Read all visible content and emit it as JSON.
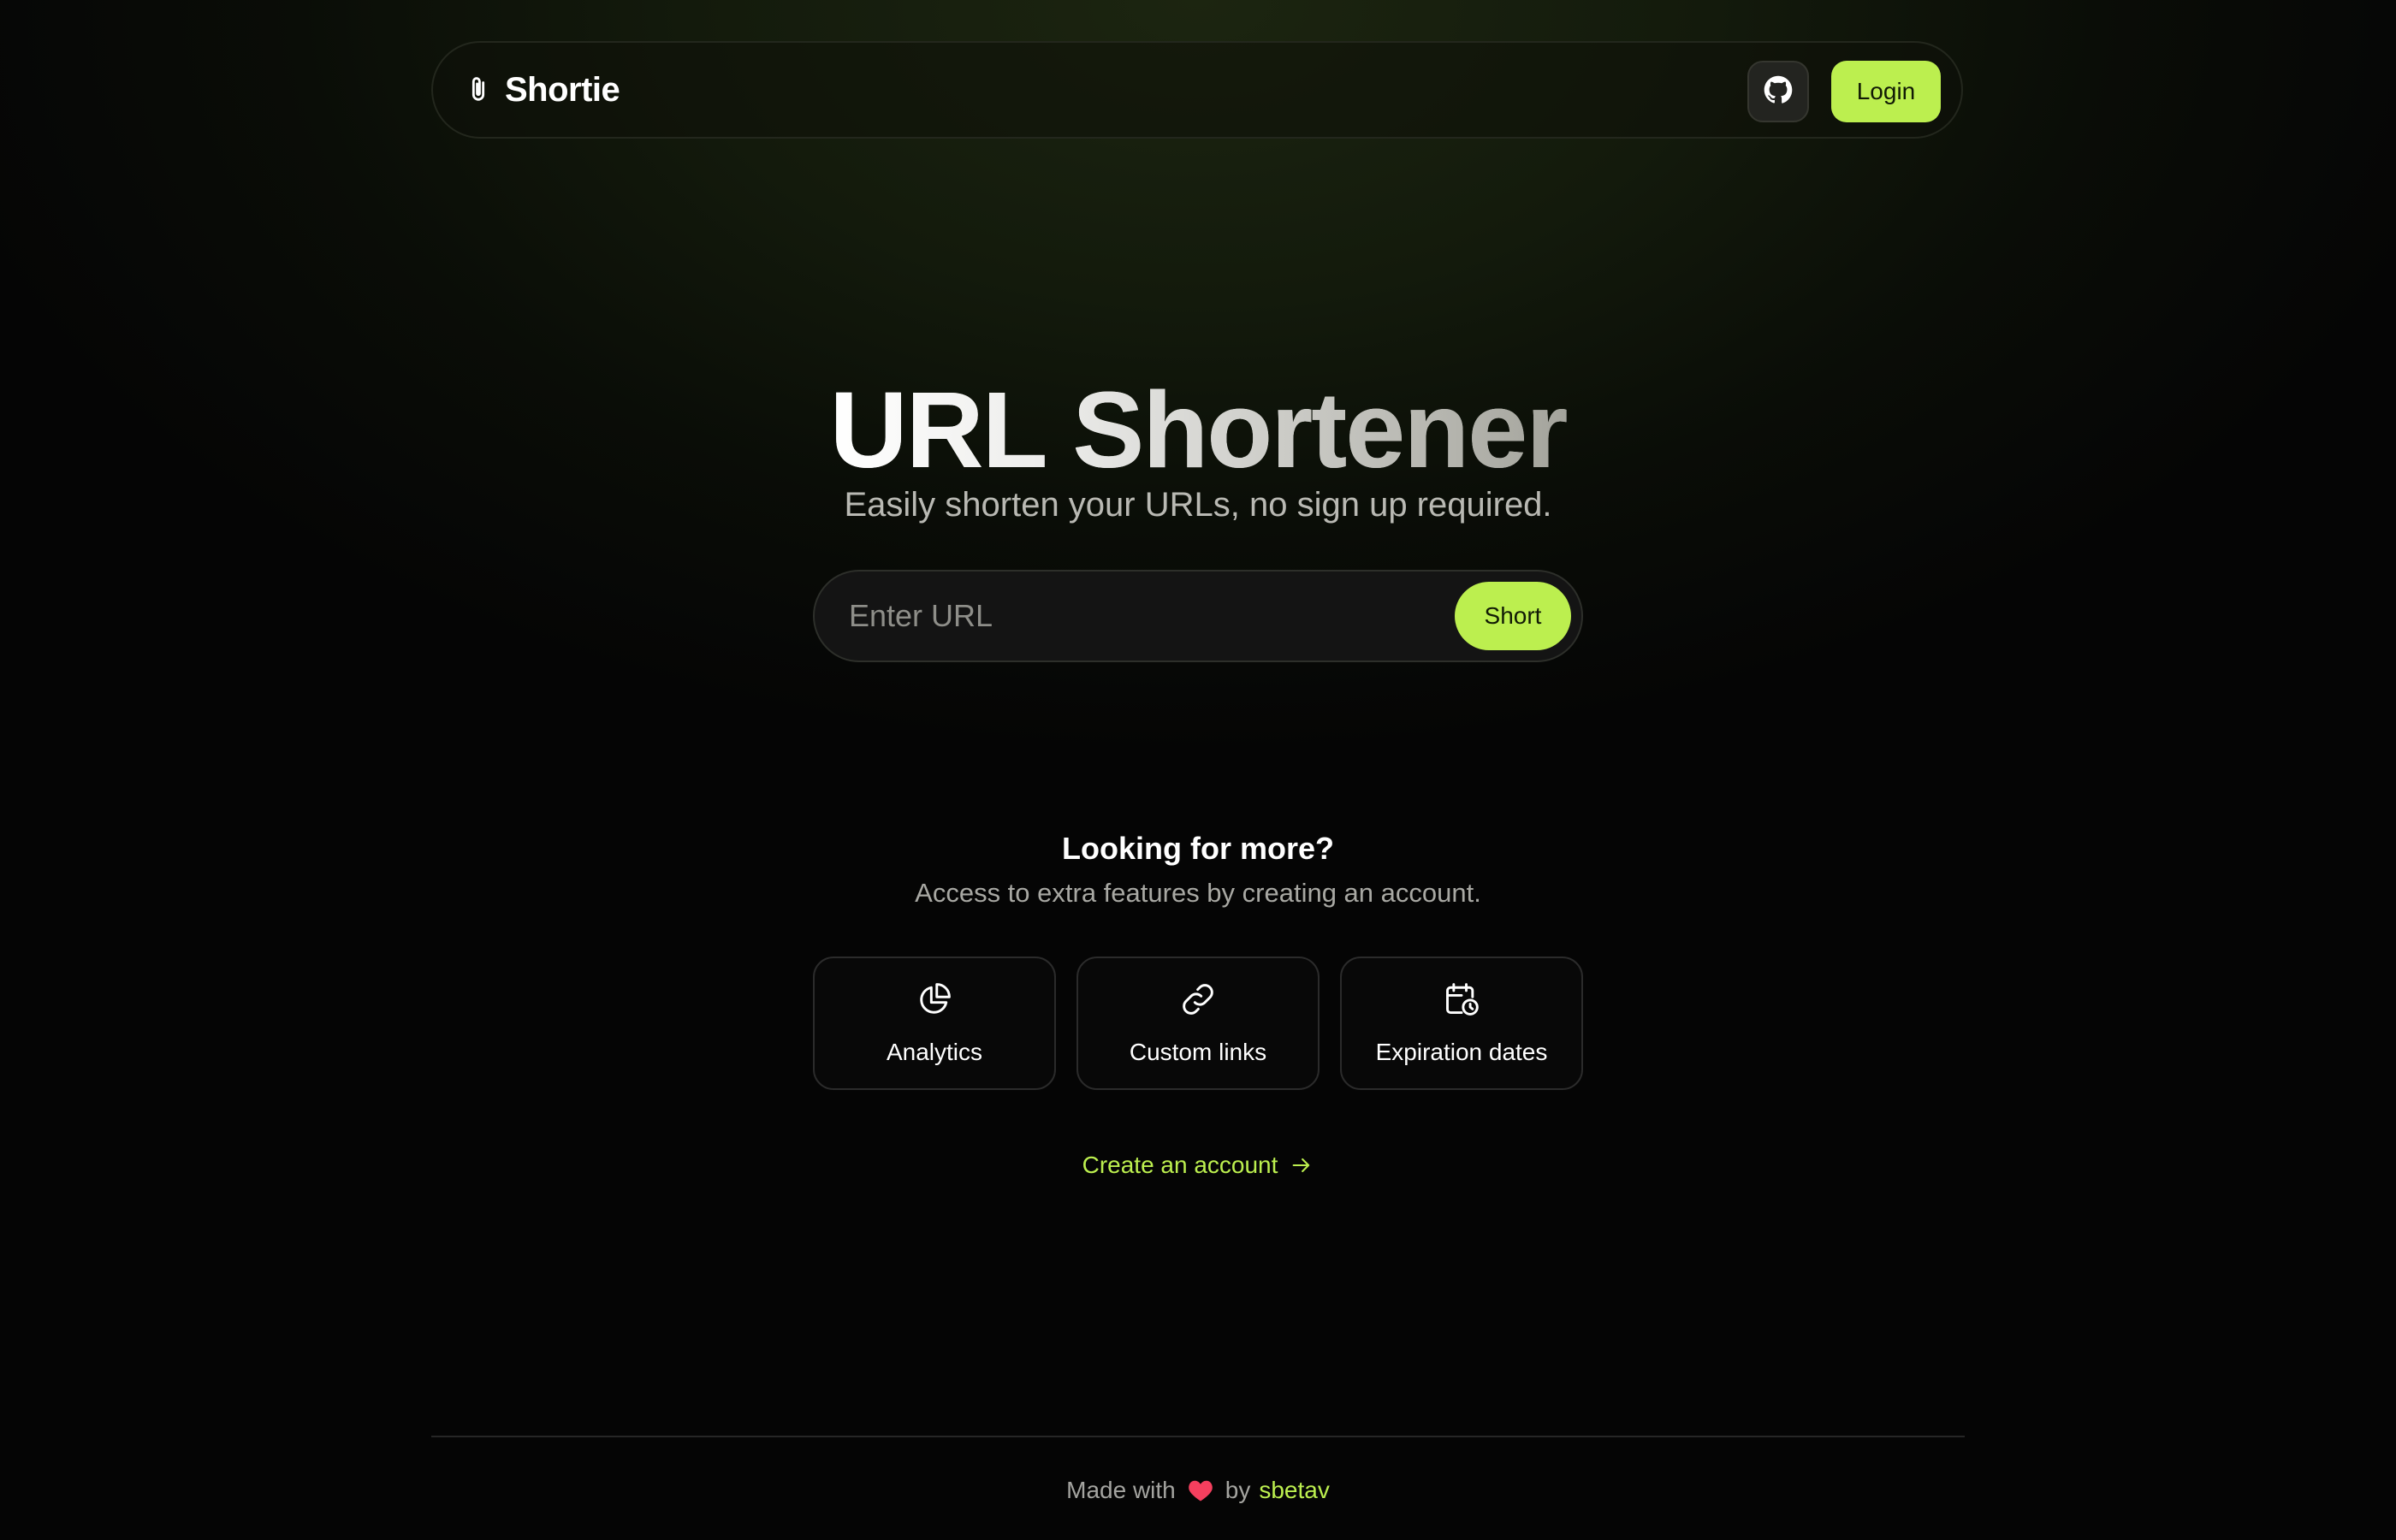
{
  "nav": {
    "brand": "Shortie",
    "brand_icon": "paperclip-icon",
    "github_icon": "github-icon",
    "login_label": "Login"
  },
  "hero": {
    "title": "URL Shortener",
    "subtitle": "Easily shorten your URLs, no sign up required.",
    "input_placeholder": "Enter URL",
    "input_value": "",
    "submit_label": "Short"
  },
  "more": {
    "heading": "Looking for more?",
    "subtitle": "Access to extra features by creating an account.",
    "features": [
      {
        "label": "Analytics",
        "icon": "pie-chart-icon"
      },
      {
        "label": "Custom links",
        "icon": "link-icon"
      },
      {
        "label": "Expiration dates",
        "icon": "calendar-clock-icon"
      }
    ],
    "cta_label": "Create an account",
    "cta_icon": "arrow-right-icon"
  },
  "footer": {
    "made_with": "Made with",
    "heart_icon": "heart-icon",
    "by": "by",
    "author": "sbetav"
  },
  "colors": {
    "accent": "#bcef4f",
    "background": "#050505",
    "heart": "#f43f5e"
  }
}
